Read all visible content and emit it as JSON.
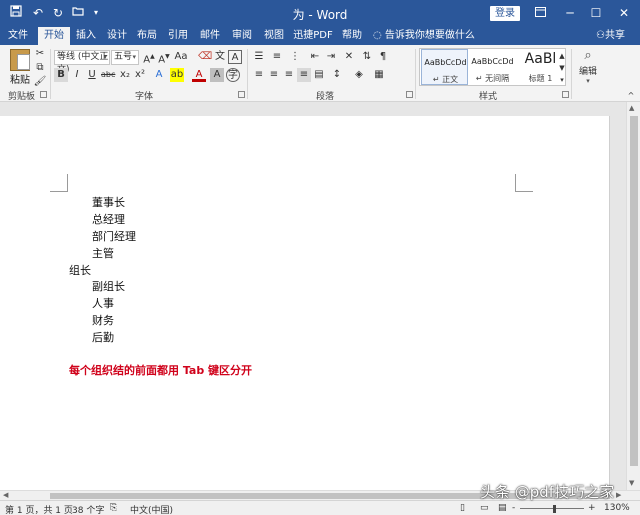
{
  "titlebar": {
    "title": "为 - Word",
    "login_label": "登录",
    "quick_access": [
      "save-icon",
      "undo-icon",
      "redo-icon",
      "open-icon",
      "customize-icon"
    ]
  },
  "tabs": {
    "file": "文件",
    "home": "开始",
    "insert": "插入",
    "design": "设计",
    "layout": "布局",
    "references": "引用",
    "mailings": "邮件",
    "review": "审阅",
    "view": "视图",
    "pdf": "迅捷PDF",
    "help": "帮助",
    "tell_me": "告诉我你想要做什么",
    "share": "共享"
  },
  "ribbon": {
    "clipboard": {
      "paste_label": "粘贴",
      "group_label": "剪贴板"
    },
    "font": {
      "font_name": "等线 (中文正文)",
      "font_size": "五号",
      "group_label": "字体"
    },
    "paragraph": {
      "group_label": "段落"
    },
    "styles": {
      "group_label": "样式",
      "items": [
        {
          "preview": "AaBbCcDd",
          "name": "↵ 正文"
        },
        {
          "preview": "AaBbCcDd",
          "name": "↵ 无间隔"
        },
        {
          "preview": "AaBl",
          "name": "标题 1"
        }
      ]
    },
    "editing": {
      "label": "编辑"
    }
  },
  "document": {
    "lines": [
      {
        "text": "董事长",
        "indent": true
      },
      {
        "text": "总经理",
        "indent": true
      },
      {
        "text": "部门经理",
        "indent": true
      },
      {
        "text": "主管",
        "indent": true
      },
      {
        "text": "组长",
        "indent": false
      },
      {
        "text": "副组长",
        "indent": true
      },
      {
        "text": "人事",
        "indent": true
      },
      {
        "text": "财务",
        "indent": true
      },
      {
        "text": "后勤",
        "indent": true
      }
    ],
    "note": "每个组织结的前面都用 Tab 键区分开",
    "note_color": "#d0021b"
  },
  "statusbar": {
    "page_info": "第 1 页，共 1 页",
    "word_count": "38 个字",
    "language": "中文(中国)",
    "zoom_minus": "-",
    "zoom_plus": "+",
    "zoom": "130%"
  },
  "watermark": "头条 @pdf技巧之家",
  "colors": {
    "word_blue": "#2b579a",
    "ribbon_bg": "#f3f3f3"
  }
}
